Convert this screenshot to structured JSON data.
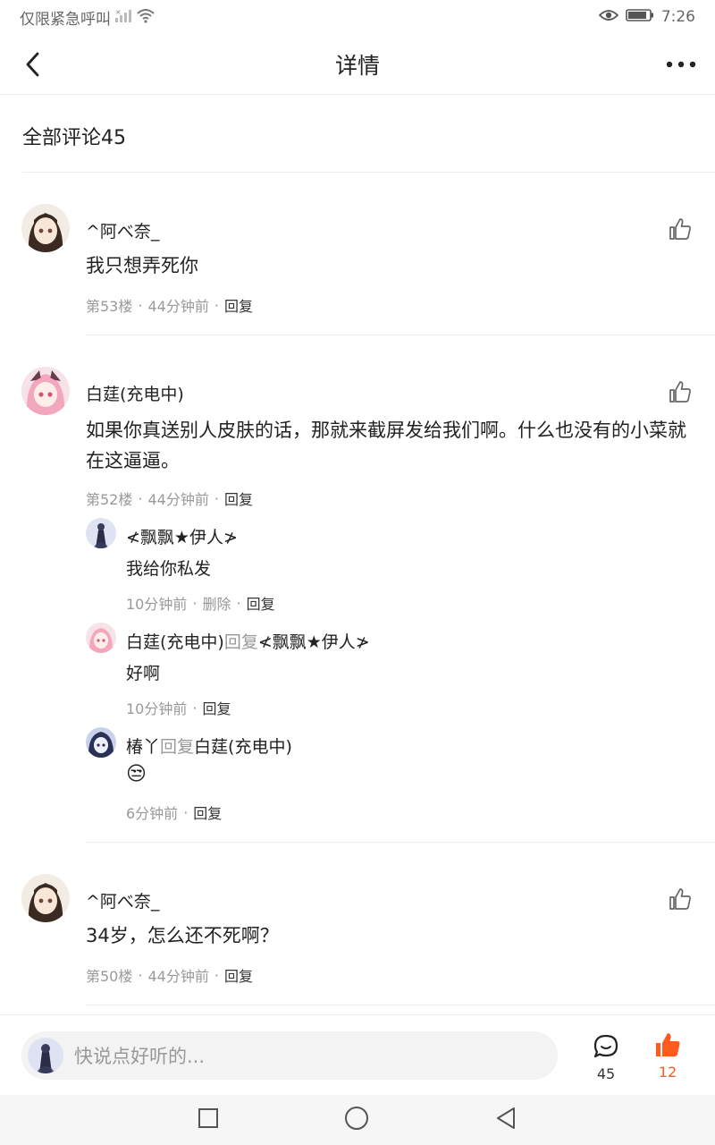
{
  "status_bar": {
    "carrier": "仅限紧急呼叫",
    "time": "7:26"
  },
  "nav": {
    "title": "详情"
  },
  "section": {
    "title": "全部评论45"
  },
  "comments": [
    {
      "name": "^阿べ奈_",
      "text": "我只想弄死你",
      "floor": "第53楼",
      "time": "44分钟前",
      "reply": "回复"
    },
    {
      "name": "白莛(充电中)",
      "text": "如果你真送别人皮肤的话，那就来截屏发给我们啊。什么也没有的小菜就在这逼逼。",
      "floor": "第52楼",
      "time": "44分钟前",
      "reply": "回复",
      "replies": [
        {
          "name": "≮飘飘★伊人≯",
          "text": "我给你私发",
          "time": "10分钟前",
          "delete": "删除",
          "reply": "回复"
        },
        {
          "name": "白莛(充电中)",
          "reply_word": "回复",
          "target": "≮飘飘★伊人≯",
          "text": "好啊",
          "time": "10分钟前",
          "reply": "回复"
        },
        {
          "name": "椿丫",
          "reply_word": "回复",
          "target": "白莛(充电中)",
          "text": "😒",
          "time": "6分钟前",
          "reply": "回复"
        }
      ]
    },
    {
      "name": "^阿べ奈_",
      "text": "34岁，怎么还不死啊？",
      "floor": "第50楼",
      "time": "44分钟前",
      "reply": "回复"
    }
  ],
  "bottom_bar": {
    "placeholder": "快说点好听的...",
    "comment_count": "45",
    "like_count": "12"
  },
  "colors": {
    "accent": "#ff5a1f",
    "text": "#222222",
    "muted": "#999999"
  }
}
